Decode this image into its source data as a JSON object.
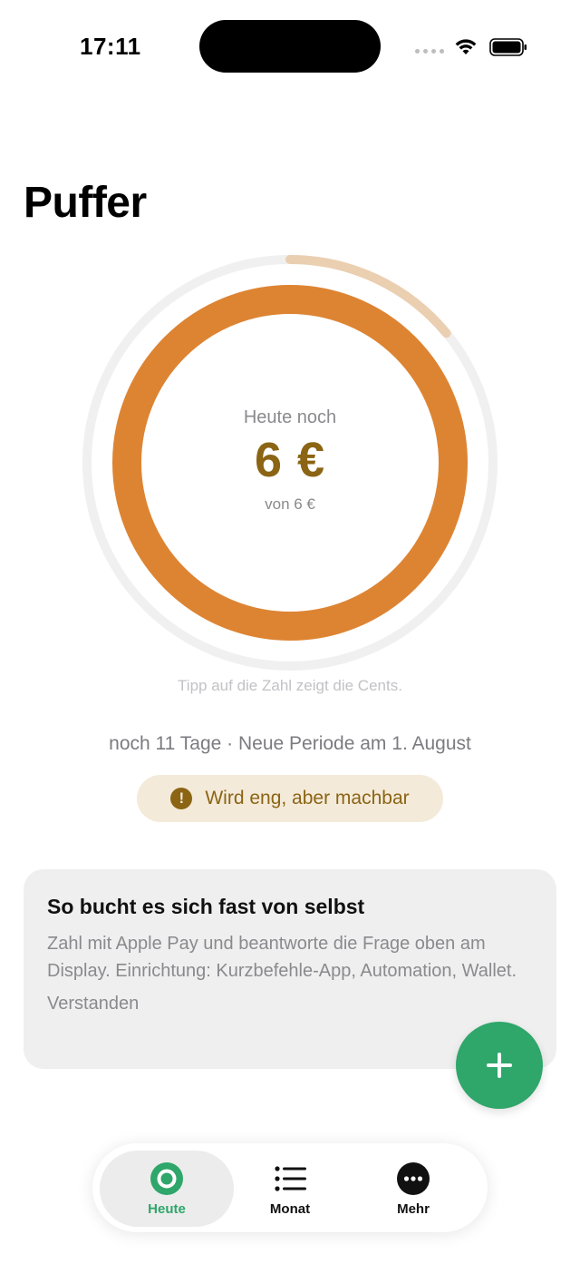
{
  "status_bar": {
    "time": "17:11",
    "icons": [
      "signal-dots-icon",
      "wifi-icon",
      "battery-icon"
    ]
  },
  "page": {
    "title": "Puffer"
  },
  "budget_ring": {
    "label": "Heute noch",
    "amount": "6 €",
    "sub": "von 6 €",
    "remaining_fraction": 1.0,
    "outer_progress_fraction": 0.14,
    "colors": {
      "ring": "#dd8433",
      "outer_track": "#f0f0f0",
      "outer_progress": "#ebcfb1",
      "amount": "#8b6414"
    }
  },
  "hints": {
    "tip": "Tipp auf die Zahl zeigt die Cents.",
    "period": "noch 11 Tage · Neue Periode am 1. August"
  },
  "warning": {
    "text": "Wird eng, aber machbar",
    "icon": "exclamation-circle-icon",
    "color": "#8b6414",
    "background": "#f4ead9"
  },
  "info_card": {
    "title": "So bucht es sich fast von selbst",
    "body": "Zahl mit Apple Pay und beantworte die Frage oben am Display. Einrichtung: Kurzbefehle-App, Automation, Wallet.",
    "action": "Verstanden"
  },
  "fab": {
    "icon": "plus-icon",
    "color": "#2fa66a"
  },
  "tab_bar": {
    "items": [
      {
        "label": "Heute",
        "icon": "ring-icon",
        "active": true
      },
      {
        "label": "Monat",
        "icon": "list-icon",
        "active": false
      },
      {
        "label": "Mehr",
        "icon": "ellipsis-circle-icon",
        "active": false
      }
    ],
    "active_color": "#2fa66a"
  }
}
